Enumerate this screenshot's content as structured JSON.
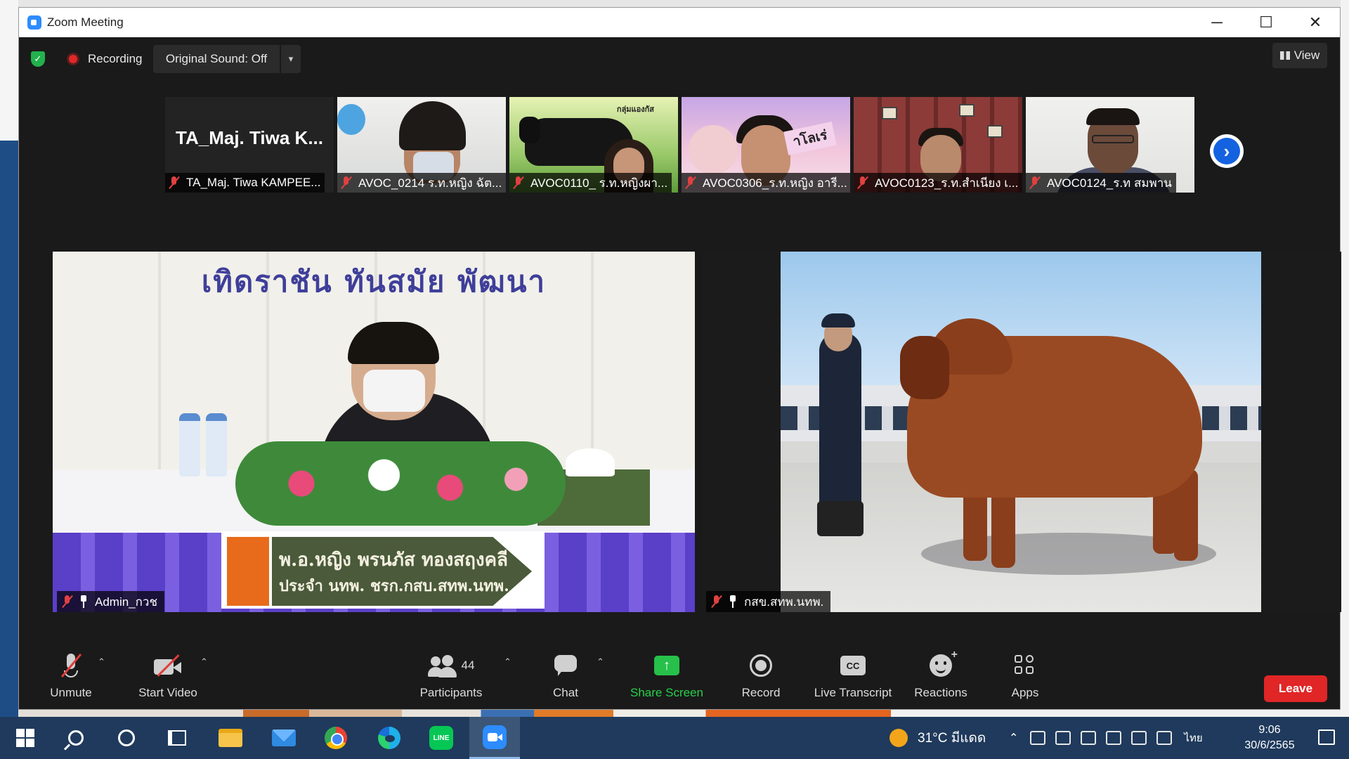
{
  "window": {
    "title": "Zoom Meeting",
    "controls": {
      "minimize": "─",
      "maximize": "☐",
      "close": "✕"
    }
  },
  "topbar": {
    "security_icon": "shield-check-icon",
    "recording_label": "Recording",
    "sound_button": "Original Sound: Off",
    "sound_caret": "▾",
    "view_label": "View"
  },
  "gallery": {
    "first_tile_name": "TA_Maj. Tiwa K...",
    "participants": [
      "TA_Maj. Tiwa KAMPEE...",
      "AVOC_0214 ร.ท.หญิง ฉัต...",
      "AVOC0110_ ร.ท.หญิงผา...",
      "AVOC0306_ร.ท.หญิง อารี...",
      "AVOC0123_ร.ท.สำเนียง เ...",
      "AVOC0124_ร.ท สมพาน"
    ],
    "thumb2_banner": "กลุ่มแองกัส",
    "thumb3_sign": "าโลเร่",
    "next_icon": "›"
  },
  "main": {
    "left": {
      "banner": "เทิดราชัน   ทันสมัย   พัฒนา",
      "nameplate_line1": "พ.อ.หญิง พรนภัส  ทองสฤงคลี",
      "nameplate_line2": "ประจำ นทพ. ชรก.กสบ.สทพ.นทพ.",
      "participant": "Admin_กวช"
    },
    "right": {
      "participant": "กสข.สทพ.นทพ."
    }
  },
  "toolbar": {
    "unmute": "Unmute",
    "start_video": "Start Video",
    "participants": "Participants",
    "participants_count": "44",
    "chat": "Chat",
    "share_screen": "Share Screen",
    "share_icon_glyph": "↑",
    "record": "Record",
    "live_transcript": "Live Transcript",
    "cc_glyph": "CC",
    "reactions": "Reactions",
    "reactions_plus": "+",
    "apps": "Apps",
    "leave": "Leave",
    "caret": "⌃",
    "share_color": "#27c04a",
    "leave_color": "#e02626"
  },
  "taskbar": {
    "line_glyph": "LINE",
    "weather": "31°C มีแดด",
    "tray_chevron": "⌃",
    "language": "ไทย",
    "time": "9:06",
    "date": "30/6/2565"
  }
}
